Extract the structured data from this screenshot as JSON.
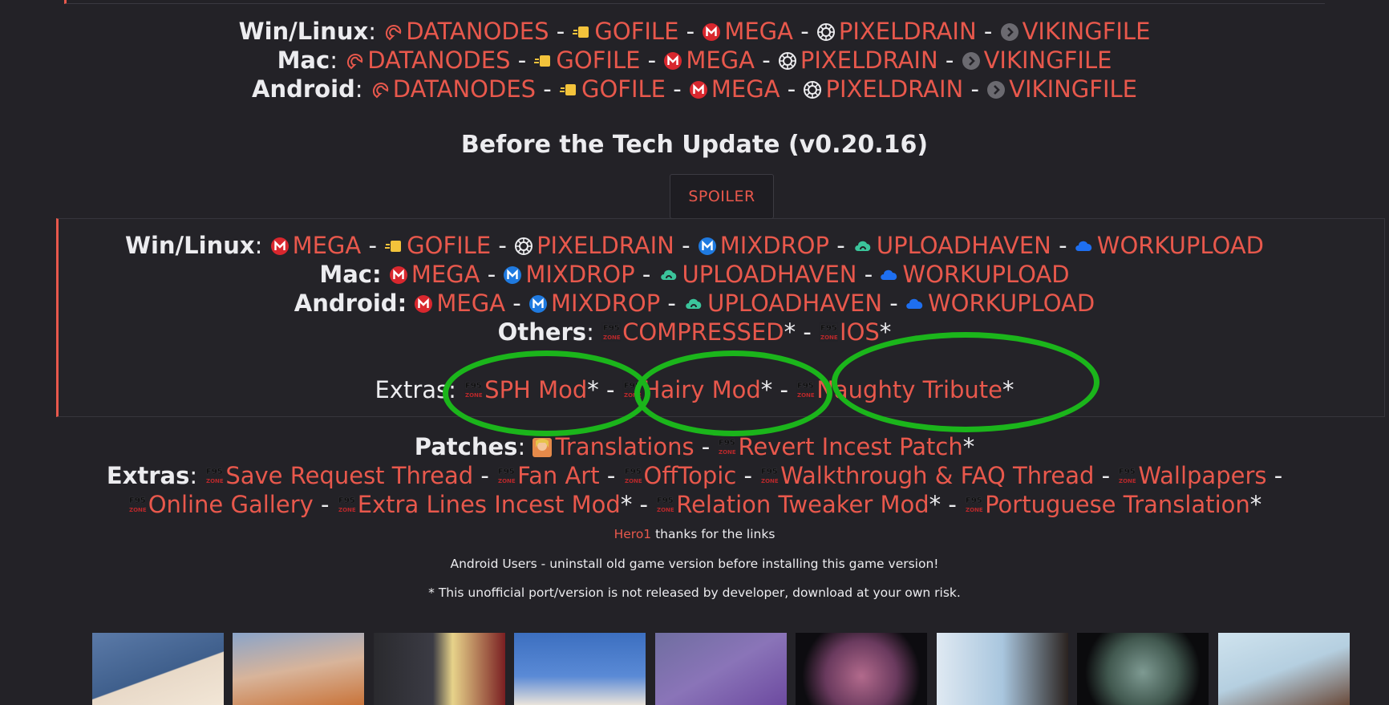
{
  "top_section": {
    "rows": [
      {
        "label": "Win/Linux",
        "links": [
          "DATANODES",
          "GOFILE",
          "MEGA",
          "PIXELDRAIN",
          "VIKINGFILE"
        ]
      },
      {
        "label": "Mac",
        "links": [
          "DATANODES",
          "GOFILE",
          "MEGA",
          "PIXELDRAIN",
          "VIKINGFILE"
        ]
      },
      {
        "label": "Android",
        "links": [
          "DATANODES",
          "GOFILE",
          "MEGA",
          "PIXELDRAIN",
          "VIKINGFILE"
        ]
      }
    ],
    "separator": "-",
    "colon": ":"
  },
  "heading": "Before the Tech Update (v0.20.16)",
  "spoiler": {
    "button_label": "SPOILER",
    "rows": [
      {
        "label": "Win/Linux",
        "links": [
          "MEGA",
          "GOFILE",
          "PIXELDRAIN",
          "MIXDROP",
          "UPLOADHAVEN",
          "WORKUPLOAD"
        ]
      },
      {
        "label": "Mac:",
        "links": [
          "MEGA",
          "MIXDROP",
          "UPLOADHAVEN",
          "WORKUPLOAD"
        ]
      },
      {
        "label": "Android:",
        "links": [
          "MEGA",
          "MIXDROP",
          "UPLOADHAVEN",
          "WORKUPLOAD"
        ]
      }
    ],
    "others": {
      "label": "Others",
      "links": [
        "COMPRESSED",
        "IOS"
      ],
      "star": "*"
    },
    "extras": {
      "label": "Extras",
      "links": [
        "SPH Mod",
        "Hairy Mod",
        "Naughty Tribute"
      ],
      "star": "*"
    }
  },
  "patches": {
    "label": "Patches",
    "links": [
      "Translations",
      "Revert Incest Patch"
    ],
    "star": "*"
  },
  "extras": {
    "label": "Extras",
    "links": [
      "Save Request Thread",
      "Fan Art",
      "OffTopic",
      "Walkthrough & FAQ Thread",
      "Wallpapers",
      "Online Gallery",
      "Extra Lines Incest Mod",
      "Relation Tweaker Mod",
      "Portuguese Translation"
    ],
    "star": "*"
  },
  "credit": {
    "user": "Hero1",
    "text": " thanks for the links"
  },
  "notice": "Android Users - uninstall old game version before installing this game version!",
  "disclaimer": "* This unofficial port/version is not released by developer, download at your own risk.",
  "icons": {
    "datanodes": "datanodes-icon",
    "gofile": "gofile-icon",
    "mega": "mega-icon",
    "pixeldrain": "pixeldrain-icon",
    "vikingfile": "vikingfile-icon",
    "mixdrop": "mixdrop-icon",
    "uploadhaven": "uploadhaven-icon",
    "workupload": "workupload-icon",
    "f95": "f95zone-icon"
  },
  "colors": {
    "link": "#e8584c",
    "text": "#ececef",
    "background": "#232227",
    "annotation": "#1bb51b",
    "mega": "#d9272e",
    "mixdrop": "#1f7ae0",
    "uploadhaven": "#3bc49b",
    "workupload": "#1e6ff0"
  }
}
